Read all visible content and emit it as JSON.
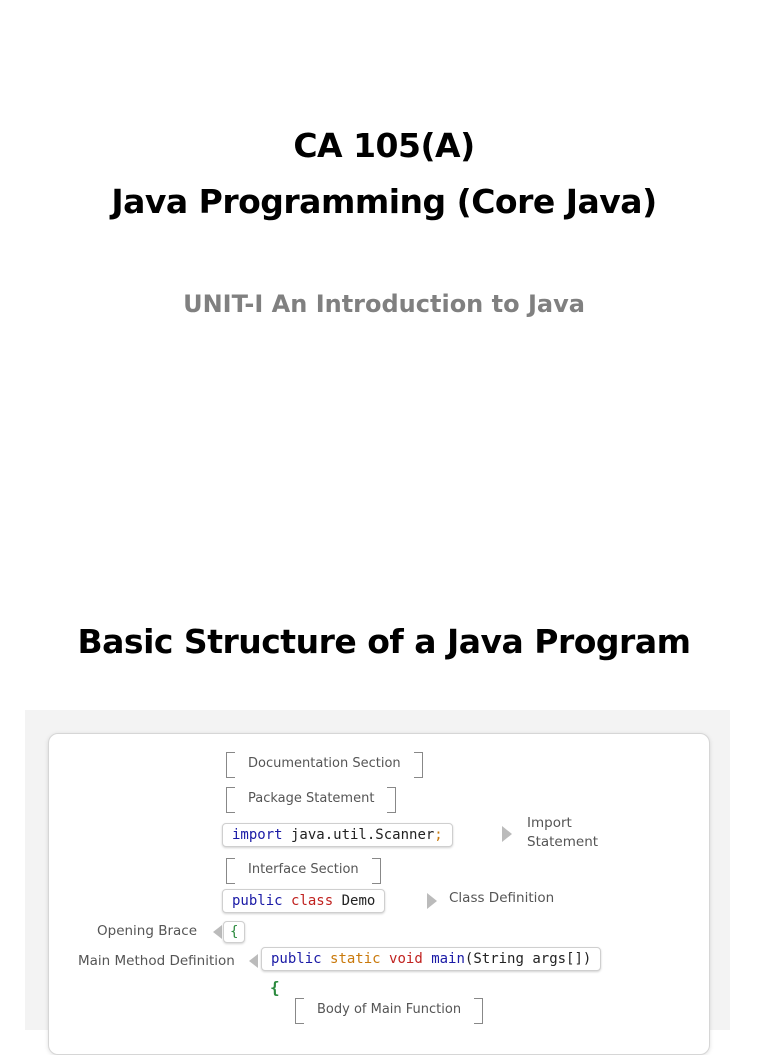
{
  "slide1": {
    "title_line1": "CA 105(A)",
    "title_line2": "Java Programming (Core Java)",
    "subtitle": "UNIT-I An Introduction to Java"
  },
  "slide2": {
    "title": "Basic Structure of a Java Program",
    "diagram": {
      "documentation_section": "Documentation Section",
      "package_statement": "Package Statement",
      "import_code": {
        "keyword": "import",
        "rest": " java.util.Scanner",
        "semicolon": ";"
      },
      "import_label_line1": "Import",
      "import_label_line2": "Statement",
      "interface_section": "Interface Section",
      "class_code": {
        "kw_public": "public",
        "kw_class": "class",
        "name": "Demo"
      },
      "class_label": "Class Definition",
      "opening_brace_label": "Opening Brace",
      "opening_brace": "{",
      "main_label": "Main Method Definition",
      "main_code": {
        "kw_public": "public",
        "kw_static": "static",
        "kw_void": "void",
        "kw_main": "main",
        "params": "(String args[])"
      },
      "inner_brace": "{",
      "body_of_main": "Body of Main Function"
    }
  }
}
